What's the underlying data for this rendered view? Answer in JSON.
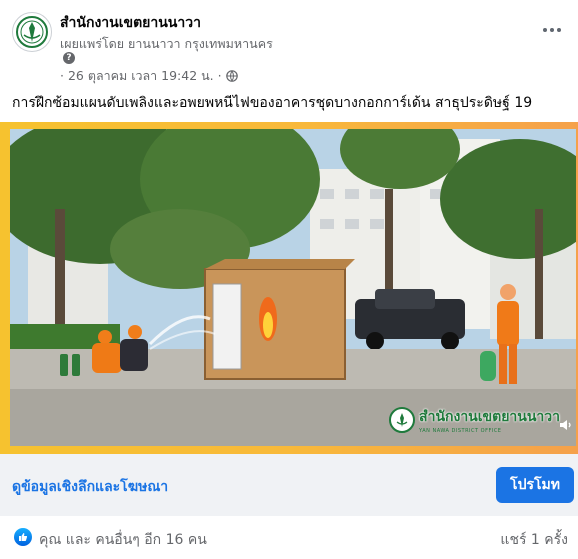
{
  "post": {
    "page_name": "สำนักงานเขตยานนาวา",
    "byline": "เผยแพร่โดย ยานนาวา กรุงเทพมหานคร",
    "date": "· 26 ตุลาคม เวลา 19:42 น. ·",
    "text": "การฝึกซ้อมแผนดับเพลิงและอพยพหนีไฟของอาคารชุดบางกอกการ์เด้น สาธุประดิษฐ์ 19"
  },
  "media": {
    "watermark_name": "สำนักงานเขตยานนาวา",
    "watermark_sub": "YAN NAWA DISTRICT OFFICE",
    "icons": [
      "play-video",
      "volume-icon"
    ]
  },
  "cta": {
    "link_label": "ดูข้อมูลเชิงลึกและโฆษณา",
    "promote_label": "โปรโมท"
  },
  "reactions": {
    "summary": "คุณ และ คนอื่นๆ อีก 16 คน",
    "shares": "แชร์ 1 ครั้ง"
  },
  "colors": {
    "accent": "#1b74e4",
    "secondary_text": "#65676b",
    "cta_bg": "#f0f2f5",
    "frame_yellow": "#f6c22f"
  }
}
